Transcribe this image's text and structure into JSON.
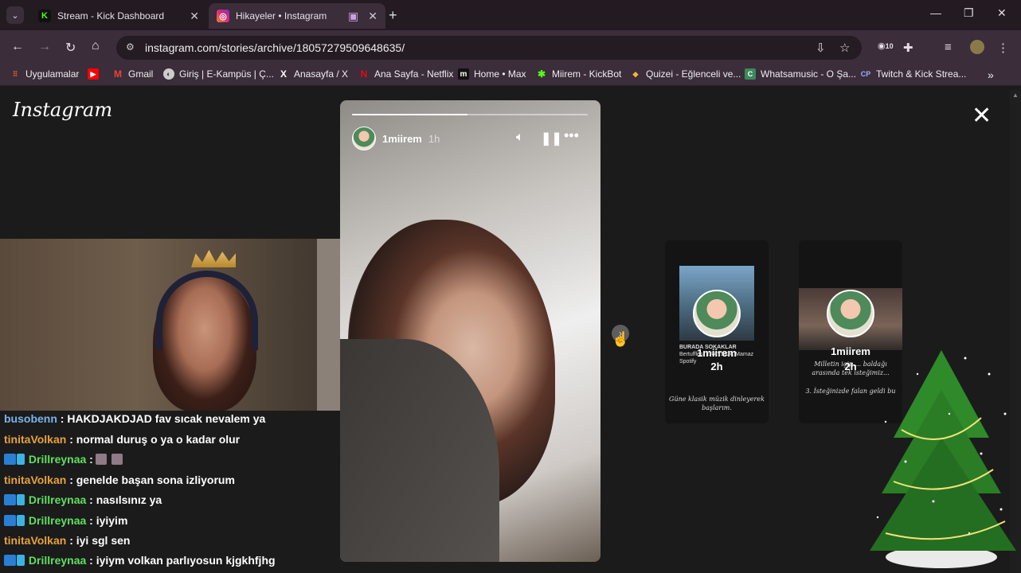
{
  "browser": {
    "tabs": [
      {
        "title": "Stream - Kick Dashboard",
        "favicon": "kick-logo",
        "color": "#53fc18"
      },
      {
        "title": "Hikayeler • Instagram",
        "favicon": "instagram-logo",
        "color": "#e1306c"
      }
    ],
    "url": "instagram.com/stories/archive/18057279509648635/",
    "extension_badge": "10",
    "bookmarks": [
      {
        "label": "Uygulamalar",
        "icon": "apps-grid-icon"
      },
      {
        "label": "",
        "icon": "youtube-icon"
      },
      {
        "label": "Gmail",
        "icon": "gmail-icon"
      },
      {
        "label": "Giriş | E-Kampüs | Ç...",
        "icon": "ekampus-icon"
      },
      {
        "label": "Anasayfa / X",
        "icon": "x-icon"
      },
      {
        "label": "Ana Sayfa - Netflix",
        "icon": "netflix-icon"
      },
      {
        "label": "Home • Max",
        "icon": "max-icon"
      },
      {
        "label": "Miirem - KickBot",
        "icon": "kickbot-icon"
      },
      {
        "label": "Quizei - Eğlenceli ve...",
        "icon": "quizei-icon"
      },
      {
        "label": "Whatsamusic - O Şa...",
        "icon": "whatsamusic-icon"
      },
      {
        "label": "Twitch & Kick Strea...",
        "icon": "cp-icon"
      }
    ]
  },
  "instagram": {
    "logo_text": "Instagram",
    "story": {
      "username": "1miirem",
      "time": "1h",
      "progress": 0.49
    },
    "previews": [
      {
        "username": "1miirem",
        "time": "2h",
        "song_title": "BURADA SOKAKLAR",
        "song_artist": "Bertuffles, ERAYSKR, Mamaz",
        "song_source": "Spotify",
        "caption": "Güne klasik müzik dinleyerek başlarım."
      },
      {
        "username": "1miirem",
        "time": "2h",
        "caption_top": "Milletin içip ... baldağı arasında tek isteğimiz...",
        "caption": "3. İsteğinizde falan geldi bu"
      }
    ]
  },
  "chat": {
    "messages": [
      {
        "user": "busobenn",
        "text": ": HAKDJAKDJAD fav sıcak nevalem ya",
        "color": "#7ab4e8",
        "badge": false
      },
      {
        "user": "tinitaVolkan",
        "text": ": normal duruş o ya o kadar olur",
        "color": "#e8a23a",
        "badge": false
      },
      {
        "user": "Drillreynaa",
        "text": ":",
        "color": "#5fe05f",
        "badge": true,
        "emotes": 2
      },
      {
        "user": "tinitaVolkan",
        "text": ": genelde başan sona izliyorum",
        "color": "#e8a23a",
        "badge": false
      },
      {
        "user": "Drillreynaa",
        "text": ": nasılsınız ya",
        "color": "#5fe05f",
        "badge": true
      },
      {
        "user": "Drillreynaa",
        "text": ": iyiyim",
        "color": "#5fe05f",
        "badge": true
      },
      {
        "user": "tinitaVolkan",
        "text": ": iyi sgl sen",
        "color": "#e8a23a",
        "badge": false
      },
      {
        "user": "Drillreynaa",
        "text": ": iyiym volkan parlıyosun kjgkhfjhg",
        "color": "#5fe05f",
        "badge": true
      }
    ]
  }
}
